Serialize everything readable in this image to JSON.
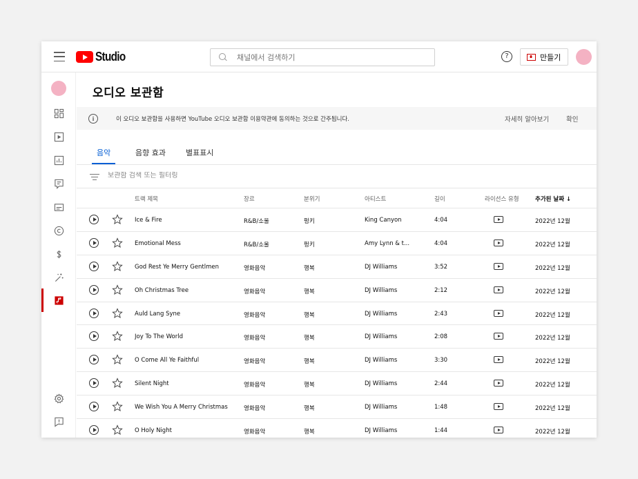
{
  "app": {
    "logo_text": "Studio"
  },
  "header": {
    "search_placeholder": "채널에서 검색하기",
    "help": "?",
    "create_label": "만들기"
  },
  "sidebar": {
    "items": [
      {
        "icon": "dashboard-icon"
      },
      {
        "icon": "content-icon"
      },
      {
        "icon": "analytics-icon"
      },
      {
        "icon": "comments-icon"
      },
      {
        "icon": "subtitles-icon"
      },
      {
        "icon": "copyright-icon"
      },
      {
        "icon": "earn-icon"
      },
      {
        "icon": "customization-icon"
      },
      {
        "icon": "audio-library-icon",
        "active": true
      },
      {
        "icon": "settings-icon"
      },
      {
        "icon": "feedback-icon"
      }
    ]
  },
  "page": {
    "title": "오디오 보관함",
    "notice": {
      "text": "이 오디오 보관함을 사용하면 YouTube 오디오 보관함 이용약관에 동의하는 것으로 간주됩니다.",
      "learn_more": "자세히 알아보기",
      "confirm": "확인"
    },
    "tabs": [
      {
        "label": "음악",
        "active": true
      },
      {
        "label": "음향 효과"
      },
      {
        "label": "별표표시"
      }
    ],
    "filter_placeholder": "보관함 검색 또는 필터링"
  },
  "table": {
    "columns": {
      "title": "트랙 제목",
      "genre": "장르",
      "mood": "분위기",
      "artist": "아티스트",
      "length": "길이",
      "license": "라이선스 유형",
      "added": "추가된 날짜",
      "sort_arrow": "↓"
    },
    "rows": [
      {
        "title": "Ice & Fire",
        "genre": "R&B/소울",
        "mood": "펑키",
        "artist": "King Canyon",
        "length": "4:04",
        "added": "2022년 12월"
      },
      {
        "title": "Emotional Mess",
        "genre": "R&B/소울",
        "mood": "펑키",
        "artist": "Amy Lynn & t...",
        "length": "4:04",
        "added": "2022년 12월"
      },
      {
        "title": "God Rest Ye Merry Gentlmen",
        "genre": "영화음악",
        "mood": "행복",
        "artist": "DJ Williams",
        "length": "3:52",
        "added": "2022년 12월"
      },
      {
        "title": "Oh Christmas Tree",
        "genre": "영화음악",
        "mood": "행복",
        "artist": "DJ Williams",
        "length": "2:12",
        "added": "2022년 12월"
      },
      {
        "title": "Auld Lang Syne",
        "genre": "영화음악",
        "mood": "행복",
        "artist": "DJ Williams",
        "length": "2:43",
        "added": "2022년 12월"
      },
      {
        "title": "Joy To The World",
        "genre": "영화음악",
        "mood": "행복",
        "artist": "DJ Williams",
        "length": "2:08",
        "added": "2022년 12월"
      },
      {
        "title": "O Come All Ye Faithful",
        "genre": "영화음악",
        "mood": "행복",
        "artist": "DJ Williams",
        "length": "3:30",
        "added": "2022년 12월"
      },
      {
        "title": "Silent Night",
        "genre": "영화음악",
        "mood": "행복",
        "artist": "DJ Williams",
        "length": "2:44",
        "added": "2022년 12월"
      },
      {
        "title": "We Wish You A Merry Christmas",
        "genre": "영화음악",
        "mood": "행복",
        "artist": "DJ Williams",
        "length": "1:48",
        "added": "2022년 12월"
      },
      {
        "title": "O Holy Night",
        "genre": "영화음악",
        "mood": "행복",
        "artist": "DJ Williams",
        "length": "1:44",
        "added": "2022년 12월"
      }
    ]
  },
  "colors": {
    "accent": "#065fd4",
    "brand_red": "#ff0000",
    "active_sidebar": "#cc0000",
    "avatar": "#f4b2c3"
  }
}
